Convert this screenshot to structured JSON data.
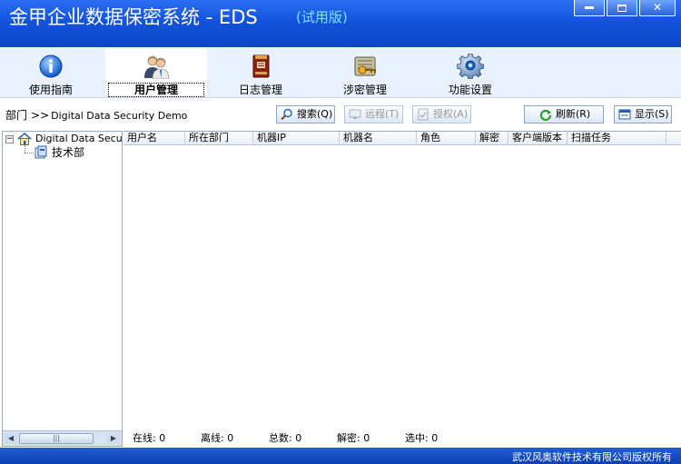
{
  "window": {
    "title": "金甲企业数据保密系统 - EDS",
    "edition": "(试用版)",
    "minimize_label": "",
    "restore_label": "",
    "close_label": "✕"
  },
  "toolbar": {
    "tabs": [
      {
        "label": "使用指南",
        "icon": "info-icon"
      },
      {
        "label": "用户管理",
        "icon": "users-icon",
        "active": true
      },
      {
        "label": "日志管理",
        "icon": "log-book-icon"
      },
      {
        "label": "涉密管理",
        "icon": "secret-key-icon"
      },
      {
        "label": "功能设置",
        "icon": "gear-icon"
      }
    ]
  },
  "breadcrumb": {
    "label": "部门",
    "separator": ">>",
    "node": "Digital Data Security Demo"
  },
  "actions": {
    "search": "搜索(Q)",
    "remote": "远程(T)",
    "authorize": "授权(A)",
    "refresh": "刷新(R)",
    "display": "显示(S)"
  },
  "tree": {
    "root": "Digital Data Security Demo",
    "root_expander": "−",
    "children": [
      "技术部"
    ]
  },
  "grid": {
    "columns": [
      "用户名",
      "所在部门",
      "机器IP",
      "机器名",
      "角色",
      "解密",
      "客户端版本",
      "扫描任务"
    ],
    "rows": []
  },
  "status": {
    "online": "在线: 0",
    "offline": "离线: 0",
    "total": "总数: 0",
    "decrypted": "解密: 0",
    "selected": "选中: 0"
  },
  "footer": {
    "copyright": "武汉风奥软件技术有限公司版权所有"
  }
}
